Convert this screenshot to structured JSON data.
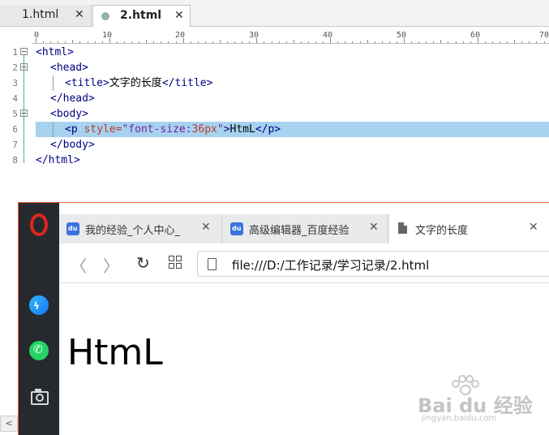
{
  "editor": {
    "tabs": [
      {
        "label": "1.html",
        "close": "✕"
      },
      {
        "label": "2.html",
        "close": "✕"
      }
    ],
    "ruler_numbers": [
      "0",
      "10",
      "20",
      "30",
      "40",
      "50",
      "60",
      "70"
    ],
    "line_numbers": [
      "1",
      "2",
      "3",
      "4",
      "5",
      "6",
      "7",
      "8"
    ],
    "lines": [
      {
        "tag": "<html>"
      },
      {
        "tag": "<head>"
      },
      {
        "tag_open": "<title>",
        "text": "文字的长度",
        "tag_close": "</title>"
      },
      {
        "tag": "</head>"
      },
      {
        "tag": "<body>"
      },
      {
        "tag_open": "<p ",
        "attr": "style=",
        "str_a": "\"font-size:",
        "str_num": "36px",
        "str_b": "\"",
        "tag_mid": ">",
        "text": "HtmL",
        "tag_close": "</p>"
      },
      {
        "tag": "</body>"
      },
      {
        "tag": "</html>"
      }
    ],
    "scroll_left": "<"
  },
  "browser": {
    "tabs": [
      {
        "title": "我的经验_个人中心_",
        "close": "✕"
      },
      {
        "title": "高级编辑器_百度经验",
        "close": "✕"
      },
      {
        "title": "文字的长度",
        "close": "✕"
      }
    ],
    "nav": {
      "back": "〈",
      "forward": "〉",
      "reload": "↻"
    },
    "url": "file:///D:/工作记录/学习记录/2.html",
    "page_text": "HtmL"
  },
  "watermark": {
    "brand": "Bai du 经验",
    "sub": "jingyan.baidu.com"
  }
}
